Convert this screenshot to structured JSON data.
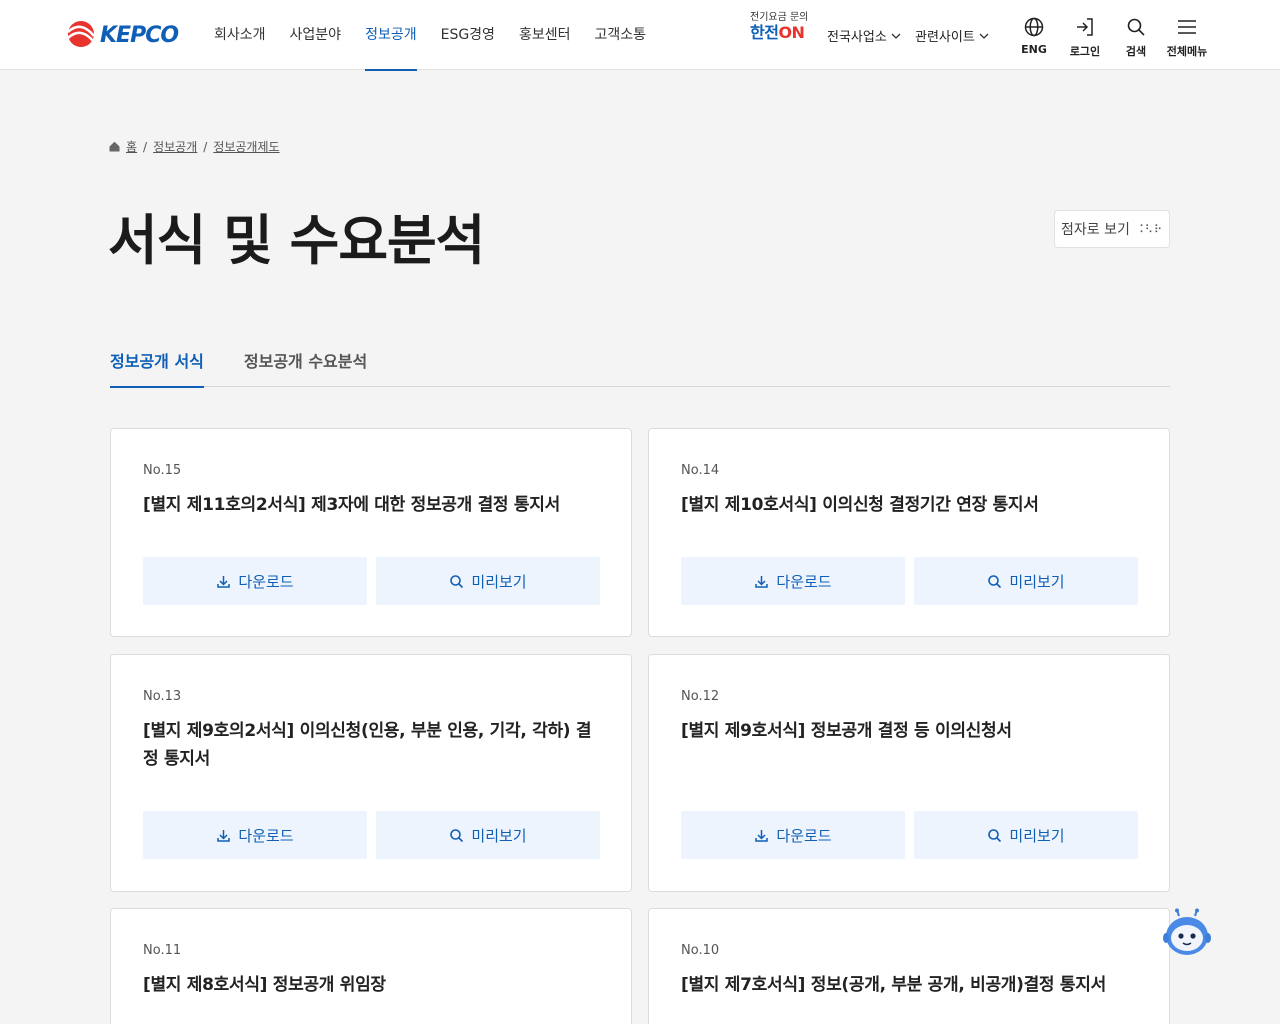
{
  "header": {
    "logo_text": "KEPCO",
    "nav": [
      "회사소개",
      "사업분야",
      "정보공개",
      "ESG경영",
      "홍보센터",
      "고객소통"
    ],
    "hanjeon_small": "전기요금 문의",
    "hanjeon_brand": "한전",
    "hanjeon_on": "ON",
    "dropdown1": "전국사업소",
    "dropdown2": "관련사이트",
    "util": [
      {
        "label": "ENG",
        "icon": "globe-icon"
      },
      {
        "label": "로그인",
        "icon": "login-icon"
      },
      {
        "label": "검색",
        "icon": "search-icon"
      },
      {
        "label": "전체메뉴",
        "icon": "menu-icon"
      }
    ],
    "accent": "#0f5fb7"
  },
  "breadcrumb": {
    "home": "홈",
    "items": [
      "정보공개",
      "정보공개제도"
    ]
  },
  "page": {
    "title": "서식 및 수요분석",
    "braille_label": "점자로 보기",
    "braille_dots": "⠨⠣⠗"
  },
  "tabs": [
    "정보공개 서식",
    "정보공개 수요분석"
  ],
  "cards": [
    {
      "no": "No.15",
      "title": "[별지 제11호의2서식] 제3자에 대한 정보공개 결정 통지서"
    },
    {
      "no": "No.14",
      "title": "[별지 제10호서식] 이의신청 결정기간 연장 통지서"
    },
    {
      "no": "No.13",
      "title": "[별지 제9호의2서식] 이의신청(인용, 부분 인용, 기각, 각하) 결정 통지서"
    },
    {
      "no": "No.12",
      "title": "[별지 제9호서식] 정보공개 결정 등 이의신청서"
    },
    {
      "no": "No.11",
      "title": "[별지 제8호서식] 정보공개 위임장"
    },
    {
      "no": "No.10",
      "title": "[별지 제7호서식] 정보(공개, 부분 공개, 비공개)결정 통지서"
    }
  ],
  "buttons": {
    "download": "다운로드",
    "preview": "미리보기"
  }
}
